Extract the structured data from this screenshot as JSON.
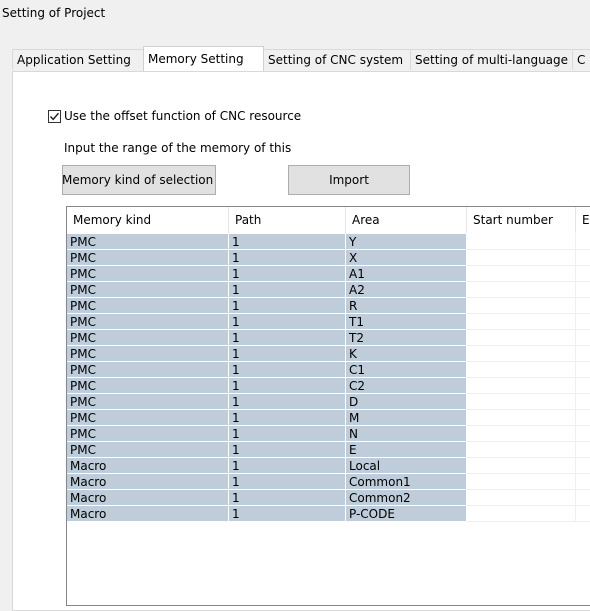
{
  "window": {
    "title": "Setting of Project"
  },
  "tabs": [
    {
      "label": "Application Setting"
    },
    {
      "label": "Memory Setting"
    },
    {
      "label": "Setting of CNC system"
    },
    {
      "label": "Setting of multi-language"
    },
    {
      "label": "C"
    }
  ],
  "memory": {
    "offset_checkbox": {
      "label": "Use the offset function of CNC resource",
      "checked": true
    },
    "range_label": "Input the range of the memory of this",
    "select_button": "Memory kind of selection",
    "import_button": "Import"
  },
  "grid": {
    "columns": [
      "Memory kind",
      "Path",
      "Area",
      "Start number",
      "E"
    ],
    "rows": [
      [
        "PMC",
        "1",
        "Y"
      ],
      [
        "PMC",
        "1",
        "X"
      ],
      [
        "PMC",
        "1",
        "A1"
      ],
      [
        "PMC",
        "1",
        "A2"
      ],
      [
        "PMC",
        "1",
        "R"
      ],
      [
        "PMC",
        "1",
        "T1"
      ],
      [
        "PMC",
        "1",
        "T2"
      ],
      [
        "PMC",
        "1",
        "K"
      ],
      [
        "PMC",
        "1",
        "C1"
      ],
      [
        "PMC",
        "1",
        "C2"
      ],
      [
        "PMC",
        "1",
        "D"
      ],
      [
        "PMC",
        "1",
        "M"
      ],
      [
        "PMC",
        "1",
        "N"
      ],
      [
        "PMC",
        "1",
        "E"
      ],
      [
        "Macro",
        "1",
        "Local"
      ],
      [
        "Macro",
        "1",
        "Common1"
      ],
      [
        "Macro",
        "1",
        "Common2"
      ],
      [
        "Macro",
        "1",
        "P-CODE"
      ]
    ]
  },
  "colors": {
    "selected_cell": "#bfcddb",
    "panel": "#ffffff",
    "window": "#f0f0f0"
  }
}
